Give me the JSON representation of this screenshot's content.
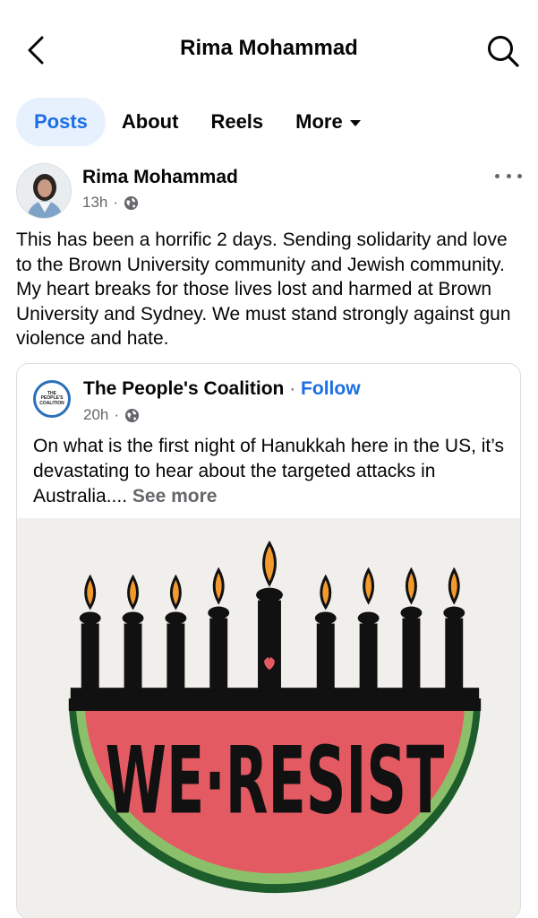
{
  "header": {
    "title": "Rima Mohammad",
    "back_icon": "chevron-left-icon",
    "search_icon": "search-icon"
  },
  "tabs": [
    {
      "label": "Posts",
      "active": true
    },
    {
      "label": "About",
      "active": false
    },
    {
      "label": "Reels",
      "active": false
    },
    {
      "label": "More",
      "active": false
    }
  ],
  "post": {
    "author": "Rima Mohammad",
    "time": "13h",
    "separator": "·",
    "privacy_icon": "globe-icon",
    "options_icon": "more-horizontal-icon",
    "text": "This has been a horrific 2 days. Sending solidarity and love to the Brown University community and Jewish community. My heart breaks for those lives lost and harmed at Brown University and Sydney. We must stand strongly against gun violence and hate."
  },
  "shared": {
    "page_name": "The People's Coalition",
    "separator": "·",
    "follow_label": "Follow",
    "time": "20h",
    "logo_text": "THE PEOPLE'S COALITION",
    "text": "On what is the first night of Hanukkah here in the US, it’s devastating to hear about the targeted attacks in Australia....",
    "see_more": "See more",
    "image_text": "WE·RESIST"
  },
  "colors": {
    "accent_blue": "#1b6ee4",
    "active_tab_bg": "#e7f0fd",
    "secondary_text": "#65676b",
    "watermelon_red": "#e45a62",
    "rind_green": "#2e7d3a"
  }
}
